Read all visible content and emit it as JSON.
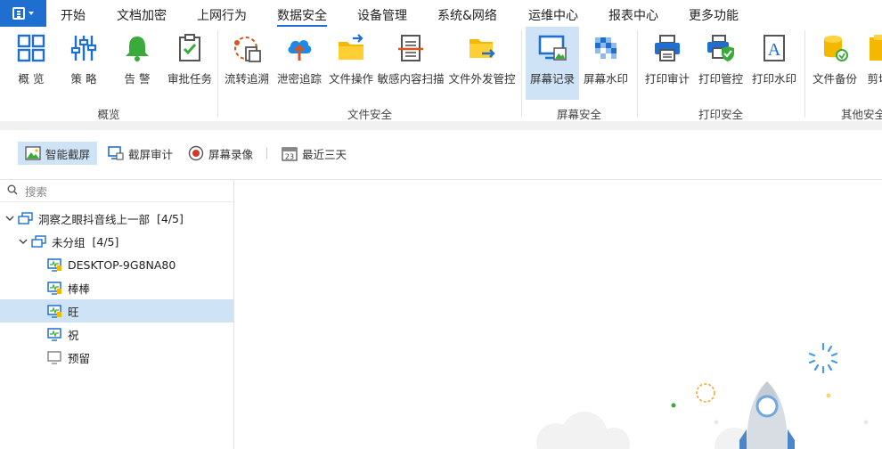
{
  "menu": {
    "items": [
      "开始",
      "文档加密",
      "上网行为",
      "数据安全",
      "设备管理",
      "系统&网络",
      "运维中心",
      "报表中心",
      "更多功能"
    ],
    "active": "数据安全"
  },
  "ribbon": {
    "tools": [
      {
        "label": "概 览",
        "icon": "overview-grid-icon"
      },
      {
        "label": "策 略",
        "icon": "policy-sliders-icon"
      },
      {
        "label": "告 警",
        "icon": "alert-bell-icon"
      },
      {
        "label": "审批任务",
        "icon": "approval-clipboard-icon"
      },
      {
        "label": "流转追溯",
        "icon": "trace-flow-icon"
      },
      {
        "label": "泄密追踪",
        "icon": "leak-cloud-icon"
      },
      {
        "label": "文件操作",
        "icon": "file-folder-icon"
      },
      {
        "label": "敏感内容扫描",
        "icon": "scan-document-icon"
      },
      {
        "label": "文件外发管控",
        "icon": "outbound-folder-icon"
      },
      {
        "label": "屏幕记录",
        "icon": "screen-record-icon"
      },
      {
        "label": "屏幕水印",
        "icon": "screen-watermark-icon"
      },
      {
        "label": "打印审计",
        "icon": "printer-icon"
      },
      {
        "label": "打印管控",
        "icon": "printer-shield-icon"
      },
      {
        "label": "打印水印",
        "icon": "font-watermark-icon"
      },
      {
        "label": "文件备份",
        "icon": "database-icon"
      },
      {
        "label": "剪切",
        "icon": "clipboard-yellow-icon"
      }
    ],
    "selected": "屏幕记录",
    "groups": [
      "概览",
      "文件安全",
      "屏幕安全",
      "打印安全",
      "其他安全"
    ]
  },
  "subbar": {
    "smart_capture": "智能截屏",
    "capture_audit": "截屏审计",
    "screen_video": "屏幕录像",
    "date_range": "最近三天",
    "calendar_day": "23"
  },
  "tree": {
    "search_placeholder": "搜索",
    "root": {
      "label": "洞察之眼抖音线上一部",
      "count": "[4/5]"
    },
    "group": {
      "label": "未分组",
      "count": "[4/5]"
    },
    "nodes": [
      {
        "label": "DESKTOP-9G8NA80",
        "status": "online"
      },
      {
        "label": "棒棒",
        "status": "online"
      },
      {
        "label": "旺",
        "status": "online"
      },
      {
        "label": "祝",
        "status": "online"
      },
      {
        "label": "预留",
        "status": "offline"
      }
    ],
    "selected": "旺"
  },
  "colors": {
    "accent": "#1f6fd0",
    "selection": "#cfe3f7",
    "green": "#3aaa3a",
    "yellow": "#f5b800"
  }
}
